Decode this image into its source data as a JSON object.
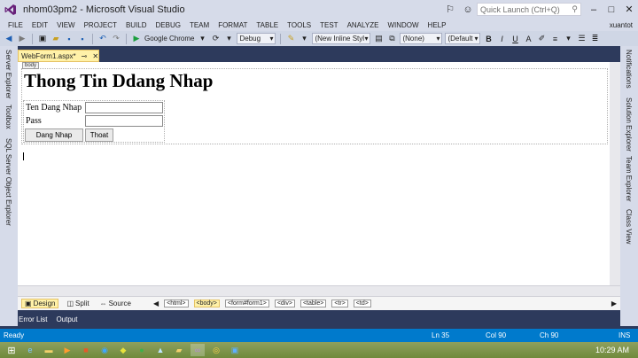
{
  "window": {
    "title": "nhom03pm2 - Microsoft Visual Studio",
    "quick_launch_placeholder": "Quick Launch (Ctrl+Q)"
  },
  "menu": [
    "FILE",
    "EDIT",
    "VIEW",
    "PROJECT",
    "BUILD",
    "DEBUG",
    "TEAM",
    "FORMAT",
    "TABLE",
    "TOOLS",
    "TEST",
    "ANALYZE",
    "WINDOW",
    "HELP"
  ],
  "user": "xuantot",
  "toolbar": {
    "browser": "Google Chrome",
    "config": "Debug",
    "style_combo": "(New Inline Style)",
    "target_combo": "(None)",
    "font_combo": "(Default",
    "bold": "B",
    "italic": "I",
    "underline": "U"
  },
  "left_strip": [
    "Server Explorer",
    "Toolbox",
    "SQL Server Object Explorer"
  ],
  "right_strip": [
    "Notifications",
    "Solution Explorer",
    "Team Explorer",
    "Class View"
  ],
  "doc_tab": {
    "label": "WebForm1.aspx*"
  },
  "design": {
    "body_tag": "body",
    "title": "Thong Tin Ddang Nhap",
    "username_label": "Ten Dang Nhap",
    "password_label": "Pass",
    "login_button": "Dang Nhap",
    "exit_button": "Thoat"
  },
  "views": {
    "design": "Design",
    "split": "Split",
    "source": "Source"
  },
  "breadcrumbs": [
    "<html>",
    "<body>",
    "<form#form1>",
    "<div>",
    "<table>",
    "<tr>",
    "<td>"
  ],
  "bottom_tabs": [
    "Error List",
    "Output"
  ],
  "status": {
    "text": "Ready",
    "line": "Ln 35",
    "col": "Col 90",
    "ch": "Ch 90",
    "mode": "INS"
  },
  "taskbar": {
    "clock": "10:29 AM"
  }
}
